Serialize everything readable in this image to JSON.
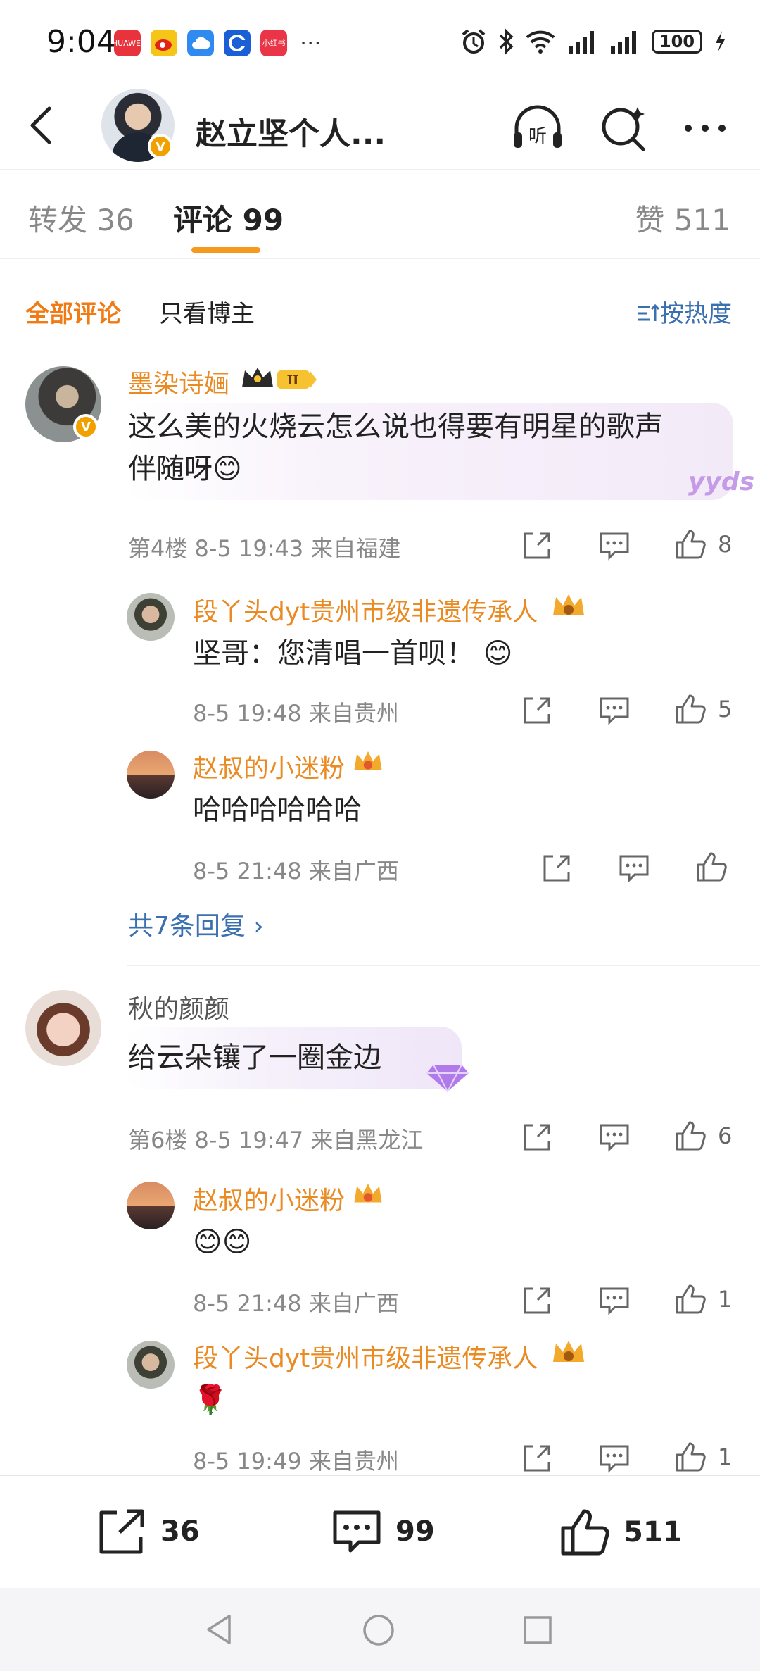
{
  "status_bar": {
    "time": "9:04",
    "apps": [
      {
        "icon": "huawei-app-icon",
        "label": "HUAWEI",
        "color": "#e8323c"
      },
      {
        "icon": "weibo-app-icon",
        "label": "",
        "color": "#f5c518"
      },
      {
        "icon": "cloud-app-icon",
        "label": "",
        "color": "#2f8bf0"
      },
      {
        "icon": "browser-app-icon",
        "label": "",
        "color": "#1a5fd6"
      },
      {
        "icon": "xiaohongshu-app-icon",
        "label": "小红书",
        "color": "#ea3447"
      }
    ],
    "more": "···",
    "battery": "100"
  },
  "header": {
    "title": "赵立坚个人...",
    "verified": "V"
  },
  "tabs": [
    {
      "label": "转发 36"
    },
    {
      "label": "评论 99"
    },
    {
      "label": "赞 511"
    }
  ],
  "filter": {
    "all": "全部评论",
    "host_only": "只看博主",
    "sort": "按热度"
  },
  "comments": [
    {
      "name": "墨染诗婳",
      "badge": "II",
      "text_line1": "这么美的火烧云怎么说也得要有明星的歌声",
      "text_line2": "伴随呀😊",
      "sticker": "yyds",
      "meta": "第4楼 8-5 19:43 来自福建",
      "likes": "8",
      "replies": [
        {
          "name": "段丫头dyt贵州市级非遗传承人",
          "text": "坚哥：您清唱一首呗！ 😊",
          "meta": "8-5 19:48 来自贵州",
          "likes": "5"
        },
        {
          "name": "赵叔的小迷粉",
          "text": "哈哈哈哈哈哈",
          "meta": "8-5 21:48 来自广西",
          "likes": ""
        }
      ],
      "more_replies": "共7条回复 ›"
    },
    {
      "name": "秋的颜颜",
      "text_line1": "给云朵镶了一圈金边",
      "meta": "第6楼 8-5 19:47 来自黑龙江",
      "likes": "6",
      "replies": [
        {
          "name": "赵叔的小迷粉",
          "text": "😊😊",
          "meta": "8-5 21:48 来自广西",
          "likes": "1"
        },
        {
          "name": "段丫头dyt贵州市级非遗传承人",
          "text": "🌹",
          "meta": "8-5 19:49 来自贵州",
          "likes": "1"
        }
      ]
    }
  ],
  "bottom_bar": {
    "repost_count": "36",
    "comment_count": "99",
    "like_count": "511"
  },
  "colors": {
    "accent": "#f07b15",
    "link": "#3a6fb0",
    "username": "#e98a23"
  }
}
